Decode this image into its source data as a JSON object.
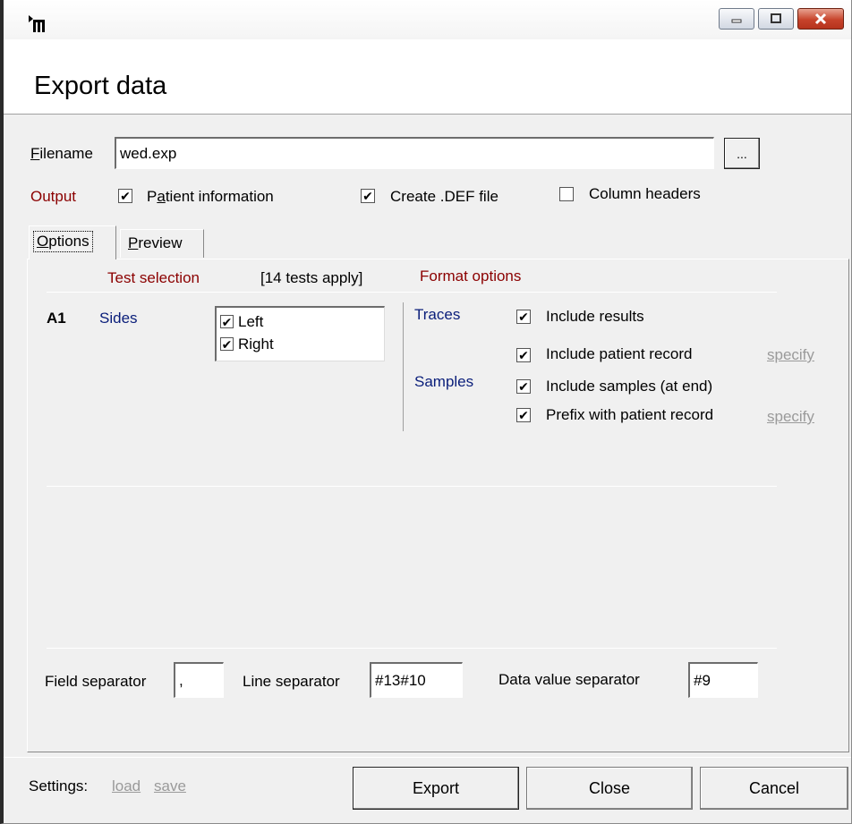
{
  "window": {
    "icon": "app-icon",
    "controls": [
      "minimize-icon",
      "maximize-icon",
      "close-icon"
    ],
    "header_title": "Export data"
  },
  "file": {
    "label": "Filename",
    "value": "wed.exp",
    "browse_label": "..."
  },
  "output": {
    "label": "Output",
    "patient_information": {
      "label": "Patient information",
      "checked": true
    },
    "create_def": {
      "label": "Create .DEF file",
      "checked": true
    },
    "column_headers": {
      "label": "Column headers",
      "checked": false
    }
  },
  "tabs": [
    {
      "label": "Options",
      "active": true
    },
    {
      "label": "Preview",
      "active": false
    }
  ],
  "options": {
    "test_selection_heading": "Test selection",
    "tests_apply": "[14 tests apply]",
    "format_options_heading": "Format options",
    "test_code": "A1",
    "sides_label": "Sides",
    "sides": [
      {
        "label": "Left",
        "checked": true
      },
      {
        "label": "Right",
        "checked": true
      }
    ],
    "traces_label": "Traces",
    "include_results": {
      "label": "Include results",
      "checked": true
    },
    "include_patient_record": {
      "label": "Include patient record",
      "checked": true
    },
    "samples_label": "Samples",
    "include_samples": {
      "label": "Include samples (at end)",
      "checked": true
    },
    "prefix_patient_record": {
      "label": "Prefix with patient record",
      "checked": true
    },
    "specify_label": "specify"
  },
  "separators": {
    "field_label": "Field separator",
    "field_value": ",",
    "line_label": "Line separator",
    "line_value": "#13#10",
    "data_value_label": "Data value separator",
    "data_value_value": "#9"
  },
  "footer": {
    "settings_label": "Settings:",
    "load_label": "load",
    "save_label": "save",
    "export_label": "Export",
    "close_label": "Close",
    "cancel_label": "Cancel"
  },
  "colors": {
    "heading_red": "#8b0000",
    "label_navy": "#0a1e7a",
    "link_gray": "#9a9a9a",
    "close_button": "#c7432b"
  }
}
